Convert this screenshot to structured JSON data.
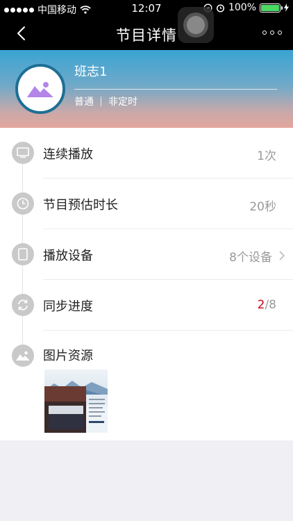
{
  "status_bar": {
    "carrier": "中国移动",
    "time": "12:07",
    "battery": "100%"
  },
  "nav": {
    "title": "节目详情"
  },
  "header": {
    "name": "班志1",
    "tag1": "普通",
    "tag2": "非定时"
  },
  "rows": [
    {
      "label": "连续播放",
      "value": "1次",
      "icon": "monitor-icon"
    },
    {
      "label": "节目预估时长",
      "value": "20秒",
      "icon": "clock-icon"
    },
    {
      "label": "播放设备",
      "value": "8个设备",
      "icon": "tablet-icon"
    },
    {
      "label": "同步进度",
      "value_done": "2",
      "value_total": "/8",
      "icon": "sync-icon"
    }
  ],
  "resources": {
    "label": "图片资源",
    "icon": "image-icon",
    "thumbnail_caption": "以梦为马 不负韶华"
  },
  "colors": {
    "nav_background": "#000000",
    "accent_red": "#d0021b",
    "avatar_purple": "#b385e8",
    "icon_grey": "#c9c9c9"
  }
}
